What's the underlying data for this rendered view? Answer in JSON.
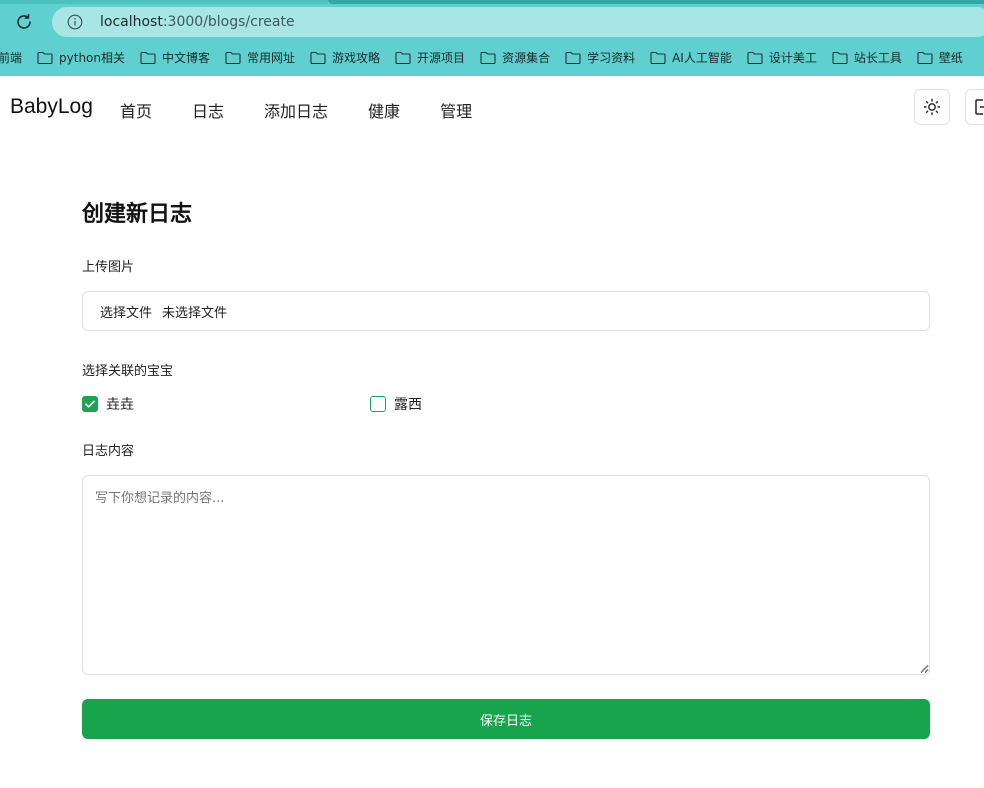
{
  "browser": {
    "url_host": "localhost",
    "url_path": ":3000/blogs/create",
    "bookmarks": [
      "前端",
      "python相关",
      "中文博客",
      "常用网址",
      "游戏攻略",
      "开源项目",
      "资源集合",
      "学习资料",
      "AI人工智能",
      "设计美工",
      "站长工具",
      "壁纸"
    ]
  },
  "nav": {
    "brand": "BabyLog",
    "links": [
      "首页",
      "日志",
      "添加日志",
      "健康",
      "管理"
    ]
  },
  "form": {
    "title": "创建新日志",
    "upload_label": "上传图片",
    "file_button": "选择文件",
    "file_status": "未选择文件",
    "babies_label": "选择关联的宝宝",
    "babies": [
      {
        "name": "垚垚",
        "checked": true
      },
      {
        "name": "露西",
        "checked": false
      }
    ],
    "content_label": "日志内容",
    "content_placeholder": "写下你想记录的内容...",
    "save_label": "保存日志"
  },
  "colors": {
    "accent": "#18a44c",
    "browser_chrome": "#5fd0cf",
    "urlbar": "#a7e6e5"
  }
}
